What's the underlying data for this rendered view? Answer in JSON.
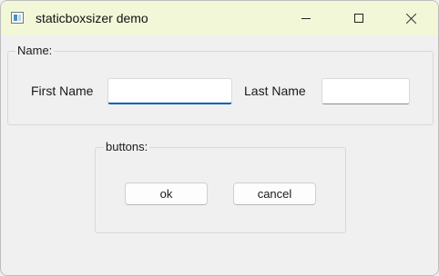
{
  "window": {
    "title": "staticboxsizer demo",
    "icons": [
      "app-icon",
      "minimize-icon",
      "maximize-icon",
      "close-icon"
    ]
  },
  "name_group": {
    "label": "Name:",
    "first_name_label": "First Name",
    "first_name_value": "",
    "last_name_label": "Last Name",
    "last_name_value": ""
  },
  "buttons_group": {
    "label": "buttons:",
    "ok_label": "ok",
    "cancel_label": "cancel"
  },
  "colors": {
    "titlebar": "#f2f7d8",
    "focus_accent": "#005fb8",
    "background": "#f0f0f0"
  }
}
